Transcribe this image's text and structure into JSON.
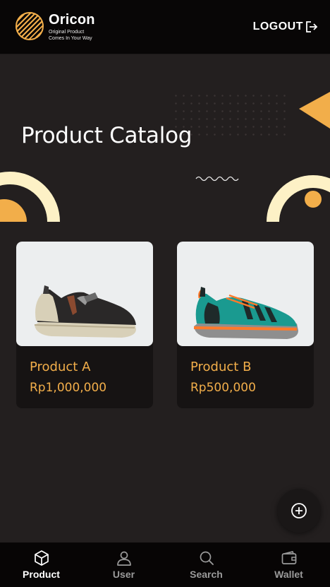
{
  "header": {
    "brand_name": "Oricon",
    "brand_tagline_1": "Original Product",
    "brand_tagline_2": "Comes In Your Way",
    "logout_label": "LOGOUT",
    "logout_icon": "logout-icon"
  },
  "hero": {
    "title": "Product Catalog"
  },
  "colors": {
    "accent": "#f2ae4a",
    "cream": "#fdf1c6",
    "background": "#231f1f",
    "card": "#161313",
    "bar": "#070505"
  },
  "products": [
    {
      "name": "Product A",
      "price": "Rp1,000,000"
    },
    {
      "name": "Product B",
      "price": "Rp500,000"
    }
  ],
  "fab": {
    "icon": "plus-circle-icon"
  },
  "nav": [
    {
      "label": "Product",
      "icon": "cube-icon",
      "active": true
    },
    {
      "label": "User",
      "icon": "user-icon",
      "active": false
    },
    {
      "label": "Search",
      "icon": "search-icon",
      "active": false
    },
    {
      "label": "Wallet",
      "icon": "wallet-icon",
      "active": false
    }
  ]
}
